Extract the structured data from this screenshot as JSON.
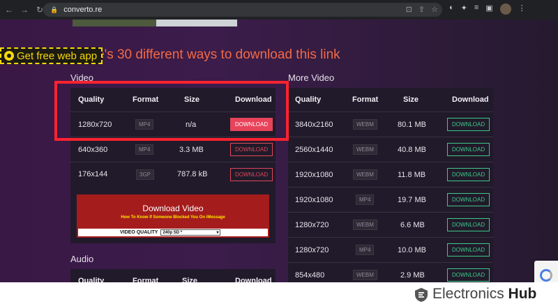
{
  "browser": {
    "url": "converto.re",
    "nav": {
      "back": "←",
      "forward": "→",
      "reload": "↻"
    }
  },
  "pwa_button": {
    "label": "Get free web app"
  },
  "headline": "e's 30 different ways to download this link",
  "video_section": {
    "label": "Video",
    "headers": [
      "Quality",
      "Format",
      "Size",
      "Download"
    ],
    "rows": [
      {
        "quality": "1280x720",
        "format": "MP4",
        "size": "n/a",
        "download": "DOWNLOAD"
      },
      {
        "quality": "640x360",
        "format": "MP4",
        "size": "3.3 MB",
        "download": "DOWNLOAD"
      },
      {
        "quality": "176x144",
        "format": "3GP",
        "size": "787.8 kB",
        "download": "DOWNLOAD"
      }
    ]
  },
  "ad_box": {
    "title": "Download Video",
    "subtitle": "How To Know If Someone Blocked You On iMessage",
    "quality_label": "VIDEO QUALITY",
    "quality_value": "240p SD *"
  },
  "audio_section": {
    "label": "Audio",
    "headers": [
      "Quality",
      "Format",
      "Size",
      "Download"
    ]
  },
  "more_video_section": {
    "label": "More Video",
    "headers": [
      "Quality",
      "Format",
      "Size",
      "Download"
    ],
    "rows": [
      {
        "quality": "3840x2160",
        "format": "WEBM",
        "size": "80.1 MB",
        "download": "DOWNLOAD"
      },
      {
        "quality": "2560x1440",
        "format": "WEBM",
        "size": "40.8 MB",
        "download": "DOWNLOAD"
      },
      {
        "quality": "1920x1080",
        "format": "WEBM",
        "size": "11.8 MB",
        "download": "DOWNLOAD"
      },
      {
        "quality": "1920x1080",
        "format": "MP4",
        "size": "19.7 MB",
        "download": "DOWNLOAD"
      },
      {
        "quality": "1280x720",
        "format": "WEBM",
        "size": "6.6 MB",
        "download": "DOWNLOAD"
      },
      {
        "quality": "1280x720",
        "format": "MP4",
        "size": "10.0 MB",
        "download": "DOWNLOAD"
      },
      {
        "quality": "854x480",
        "format": "WEBM",
        "size": "2.9 MB",
        "download": "DOWNLOAD"
      }
    ]
  },
  "watermark": {
    "brand_light": "Electronics",
    "brand_bold": "Hub"
  },
  "colors": {
    "accent_red": "#e8435a",
    "accent_green": "#3ec98a",
    "headline": "#f26a45",
    "highlight_box": "#ff2330"
  }
}
